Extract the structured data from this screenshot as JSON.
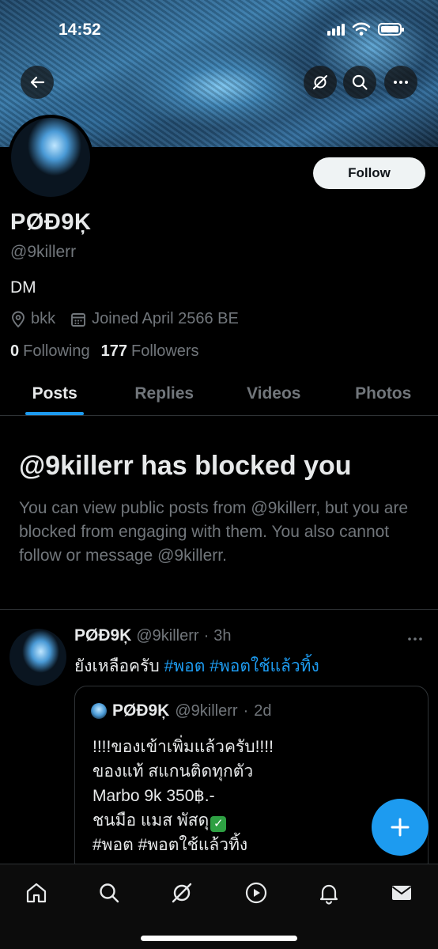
{
  "status_bar": {
    "time": "14:52"
  },
  "profile": {
    "display_name": "PØĐ9Ķ",
    "handle": "@9killerr",
    "bio": "DM",
    "location": "bkk",
    "joined": "Joined April 2566 BE",
    "following_count": "0",
    "following_label": "Following",
    "followers_count": "177",
    "followers_label": "Followers",
    "follow_button": "Follow"
  },
  "tabs": [
    {
      "label": "Posts",
      "active": true
    },
    {
      "label": "Replies",
      "active": false
    },
    {
      "label": "Videos",
      "active": false
    },
    {
      "label": "Photos",
      "active": false
    }
  ],
  "blocked_notice": {
    "title": "@9killerr has blocked you",
    "text": "You can view public posts from @9killerr, but you are blocked from engaging with them. You also cannot follow or message @9killerr."
  },
  "post": {
    "author_name": "PØĐ9Ķ",
    "author_handle": "@9killerr",
    "separator": "·",
    "time": "3h",
    "text_plain": "ยังเหลือครับ ",
    "tag1": "#พอต",
    "tag2": "#พอตใช้แล้วทิ้ง",
    "quote": {
      "author_name": "PØĐ9Ķ",
      "author_handle": "@9killerr",
      "time": "2d",
      "line1": "!!!!ของเข้าเพิ่มแล้วครับ!!!!",
      "line2": "ของแท้ สแกนติดทุกตัว",
      "line3": "Marbo 9k 350฿.-",
      "line4": "ชนมือ แมส พัสดุ",
      "line5": "#พอต #พอตใช้แล้วทิ้ง"
    }
  },
  "icons": {
    "back": "arrow-left-icon",
    "grok": "grok-icon",
    "search": "search-icon",
    "more": "more-icon",
    "location": "location-pin-icon",
    "calendar": "calendar-icon",
    "compose": "plus-icon",
    "nav": [
      "home-icon",
      "search-icon",
      "grok-icon",
      "play-icon",
      "bell-icon",
      "mail-icon"
    ]
  },
  "colors": {
    "accent": "#1d9bf0",
    "muted": "#71767b",
    "text": "#e7e9ea",
    "background": "#000000"
  }
}
